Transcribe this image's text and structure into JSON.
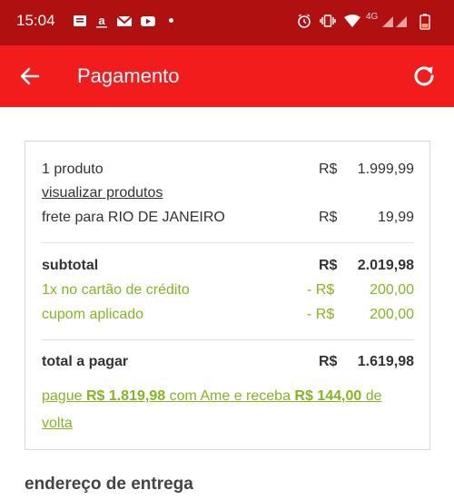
{
  "status_bar": {
    "time": "15:04",
    "network": "4G",
    "left_icons": [
      "message-icon",
      "amazon-icon",
      "gmail-icon",
      "youtube-icon"
    ],
    "right_icons": [
      "alarm-icon",
      "vibrate-icon",
      "wifi-icon",
      "signal-icon",
      "battery-icon"
    ]
  },
  "app_bar": {
    "title": "Pagamento",
    "background": "#f21c1c"
  },
  "summary": {
    "products": {
      "label": "1 produto",
      "currency": "R$",
      "value": "1.999,99"
    },
    "view_products_link": "visualizar produtos",
    "shipping": {
      "label": "frete para RIO DE JANEIRO",
      "currency": "R$",
      "value": "19,99"
    },
    "subtotal": {
      "label": "subtotal",
      "currency": "R$",
      "value": "2.019,98"
    },
    "credit_card_discount": {
      "label": "1x no cartão de crédito",
      "currency": "- R$",
      "value": "200,00"
    },
    "coupon": {
      "label": "cupom aplicado",
      "currency": "- R$",
      "value": "200,00"
    },
    "total": {
      "label": "total a pagar",
      "currency": "R$",
      "value": "1.619,98"
    },
    "ame_offer": {
      "part1": "pague ",
      "amount": "R$ 1.819,98",
      "part2": " com Ame e receba ",
      "cashback": "R$ 144,00",
      "part3": " de volta"
    }
  },
  "delivery_section_title": "endereço de entrega",
  "colors": {
    "accent_green": "#86b61f",
    "status_bar": "#b01010"
  }
}
